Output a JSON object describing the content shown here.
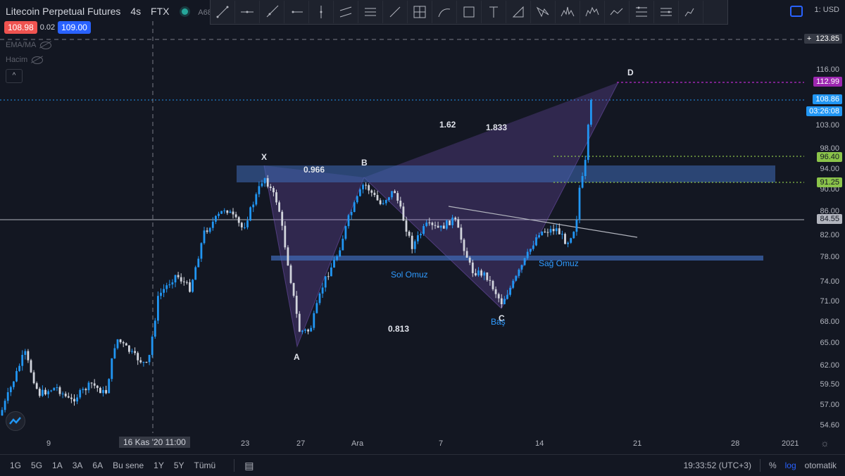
{
  "header": {
    "symbol": "Litecoin Perpetual Futures",
    "interval": "4s",
    "exchange": "FTX",
    "extra": "A68",
    "sell_price": "108.98",
    "spread": "0.02",
    "buy_price": "109.00",
    "indicator_1": "EMA/MA",
    "indicator_2": "Hacim",
    "collapse_label": "^"
  },
  "toolbar": {
    "tools": [
      "trend-line-icon",
      "horizontal-line-icon",
      "ray-icon",
      "horizontal-ray-icon",
      "vertical-line-icon",
      "parallel-channel-icon",
      "regression-icon",
      "brush-icon",
      "crosshair-grid-icon",
      "arc-icon",
      "rectangle-icon",
      "text-icon",
      "triangle-pattern-icon",
      "xabcd-pattern-icon",
      "head-shoulders-icon",
      "elliott-wave-icon",
      "zigzag-icon",
      "fib-retracement-icon",
      "gann-icon",
      "cycle-icon"
    ]
  },
  "currency": "USD",
  "currency_prefix": "1:",
  "y_axis": {
    "ticks": [
      "116.00",
      "103.00",
      "98.00",
      "94.00",
      "90.00",
      "86.00",
      "82.00",
      "78.00",
      "74.00",
      "71.00",
      "68.00",
      "65.00",
      "62.00",
      "59.50",
      "57.00",
      "54.60"
    ],
    "price_tags": {
      "crosshair": "123.85",
      "target": "112.99",
      "last": "108.86",
      "countdown": "03:26:08",
      "level_high": "96.40",
      "level_low": "91.25",
      "hline": "84.55"
    }
  },
  "x_axis": {
    "labels": [
      "9",
      "23",
      "27",
      "Ara",
      "7",
      "14",
      "21",
      "28",
      "2021"
    ],
    "crosshair_label": "16 Kas '20   11:00"
  },
  "annotations": {
    "points": [
      "X",
      "A",
      "B",
      "C",
      "D"
    ],
    "ratios": [
      "0.966",
      "0.813",
      "1.62",
      "1.833"
    ],
    "left_shoulder": "Sol Omuz",
    "head": "Baş",
    "right_shoulder": "Sağ Omuz"
  },
  "bottom_bar": {
    "timeframes": [
      "1G",
      "5G",
      "1A",
      "3A",
      "6A",
      "Bu sene",
      "1Y",
      "5Y",
      "Tümü"
    ],
    "clock": "19:33:52 (UTC+3)",
    "percent": "%",
    "log": "log",
    "auto": "otomatik"
  },
  "colors": {
    "up": "#2196f3",
    "down": "#d1d4dc",
    "pattern_fill": "#7e57c2",
    "zone_fill": "#3f6bb8",
    "target": "#9c27b0",
    "level_green": "#8bc34a",
    "accent": "#2962ff"
  }
}
